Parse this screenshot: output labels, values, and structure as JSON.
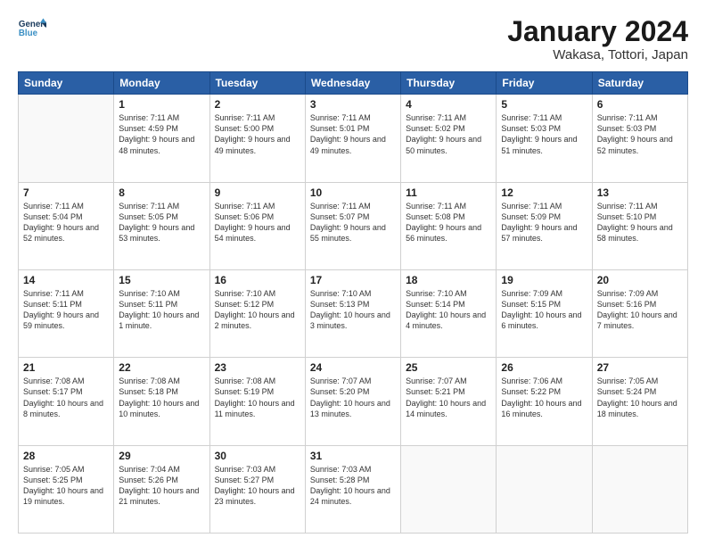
{
  "header": {
    "logo_line1": "General",
    "logo_line2": "Blue",
    "month_title": "January 2024",
    "subtitle": "Wakasa, Tottori, Japan"
  },
  "days_of_week": [
    "Sunday",
    "Monday",
    "Tuesday",
    "Wednesday",
    "Thursday",
    "Friday",
    "Saturday"
  ],
  "weeks": [
    [
      {
        "day": "",
        "content": ""
      },
      {
        "day": "1",
        "content": "Sunrise: 7:11 AM\nSunset: 4:59 PM\nDaylight: 9 hours\nand 48 minutes."
      },
      {
        "day": "2",
        "content": "Sunrise: 7:11 AM\nSunset: 5:00 PM\nDaylight: 9 hours\nand 49 minutes."
      },
      {
        "day": "3",
        "content": "Sunrise: 7:11 AM\nSunset: 5:01 PM\nDaylight: 9 hours\nand 49 minutes."
      },
      {
        "day": "4",
        "content": "Sunrise: 7:11 AM\nSunset: 5:02 PM\nDaylight: 9 hours\nand 50 minutes."
      },
      {
        "day": "5",
        "content": "Sunrise: 7:11 AM\nSunset: 5:03 PM\nDaylight: 9 hours\nand 51 minutes."
      },
      {
        "day": "6",
        "content": "Sunrise: 7:11 AM\nSunset: 5:03 PM\nDaylight: 9 hours\nand 52 minutes."
      }
    ],
    [
      {
        "day": "7",
        "content": "Sunrise: 7:11 AM\nSunset: 5:04 PM\nDaylight: 9 hours\nand 52 minutes."
      },
      {
        "day": "8",
        "content": "Sunrise: 7:11 AM\nSunset: 5:05 PM\nDaylight: 9 hours\nand 53 minutes."
      },
      {
        "day": "9",
        "content": "Sunrise: 7:11 AM\nSunset: 5:06 PM\nDaylight: 9 hours\nand 54 minutes."
      },
      {
        "day": "10",
        "content": "Sunrise: 7:11 AM\nSunset: 5:07 PM\nDaylight: 9 hours\nand 55 minutes."
      },
      {
        "day": "11",
        "content": "Sunrise: 7:11 AM\nSunset: 5:08 PM\nDaylight: 9 hours\nand 56 minutes."
      },
      {
        "day": "12",
        "content": "Sunrise: 7:11 AM\nSunset: 5:09 PM\nDaylight: 9 hours\nand 57 minutes."
      },
      {
        "day": "13",
        "content": "Sunrise: 7:11 AM\nSunset: 5:10 PM\nDaylight: 9 hours\nand 58 minutes."
      }
    ],
    [
      {
        "day": "14",
        "content": "Sunrise: 7:11 AM\nSunset: 5:11 PM\nDaylight: 9 hours\nand 59 minutes."
      },
      {
        "day": "15",
        "content": "Sunrise: 7:10 AM\nSunset: 5:11 PM\nDaylight: 10 hours\nand 1 minute."
      },
      {
        "day": "16",
        "content": "Sunrise: 7:10 AM\nSunset: 5:12 PM\nDaylight: 10 hours\nand 2 minutes."
      },
      {
        "day": "17",
        "content": "Sunrise: 7:10 AM\nSunset: 5:13 PM\nDaylight: 10 hours\nand 3 minutes."
      },
      {
        "day": "18",
        "content": "Sunrise: 7:10 AM\nSunset: 5:14 PM\nDaylight: 10 hours\nand 4 minutes."
      },
      {
        "day": "19",
        "content": "Sunrise: 7:09 AM\nSunset: 5:15 PM\nDaylight: 10 hours\nand 6 minutes."
      },
      {
        "day": "20",
        "content": "Sunrise: 7:09 AM\nSunset: 5:16 PM\nDaylight: 10 hours\nand 7 minutes."
      }
    ],
    [
      {
        "day": "21",
        "content": "Sunrise: 7:08 AM\nSunset: 5:17 PM\nDaylight: 10 hours\nand 8 minutes."
      },
      {
        "day": "22",
        "content": "Sunrise: 7:08 AM\nSunset: 5:18 PM\nDaylight: 10 hours\nand 10 minutes."
      },
      {
        "day": "23",
        "content": "Sunrise: 7:08 AM\nSunset: 5:19 PM\nDaylight: 10 hours\nand 11 minutes."
      },
      {
        "day": "24",
        "content": "Sunrise: 7:07 AM\nSunset: 5:20 PM\nDaylight: 10 hours\nand 13 minutes."
      },
      {
        "day": "25",
        "content": "Sunrise: 7:07 AM\nSunset: 5:21 PM\nDaylight: 10 hours\nand 14 minutes."
      },
      {
        "day": "26",
        "content": "Sunrise: 7:06 AM\nSunset: 5:22 PM\nDaylight: 10 hours\nand 16 minutes."
      },
      {
        "day": "27",
        "content": "Sunrise: 7:05 AM\nSunset: 5:24 PM\nDaylight: 10 hours\nand 18 minutes."
      }
    ],
    [
      {
        "day": "28",
        "content": "Sunrise: 7:05 AM\nSunset: 5:25 PM\nDaylight: 10 hours\nand 19 minutes."
      },
      {
        "day": "29",
        "content": "Sunrise: 7:04 AM\nSunset: 5:26 PM\nDaylight: 10 hours\nand 21 minutes."
      },
      {
        "day": "30",
        "content": "Sunrise: 7:03 AM\nSunset: 5:27 PM\nDaylight: 10 hours\nand 23 minutes."
      },
      {
        "day": "31",
        "content": "Sunrise: 7:03 AM\nSunset: 5:28 PM\nDaylight: 10 hours\nand 24 minutes."
      },
      {
        "day": "",
        "content": ""
      },
      {
        "day": "",
        "content": ""
      },
      {
        "day": "",
        "content": ""
      }
    ]
  ]
}
